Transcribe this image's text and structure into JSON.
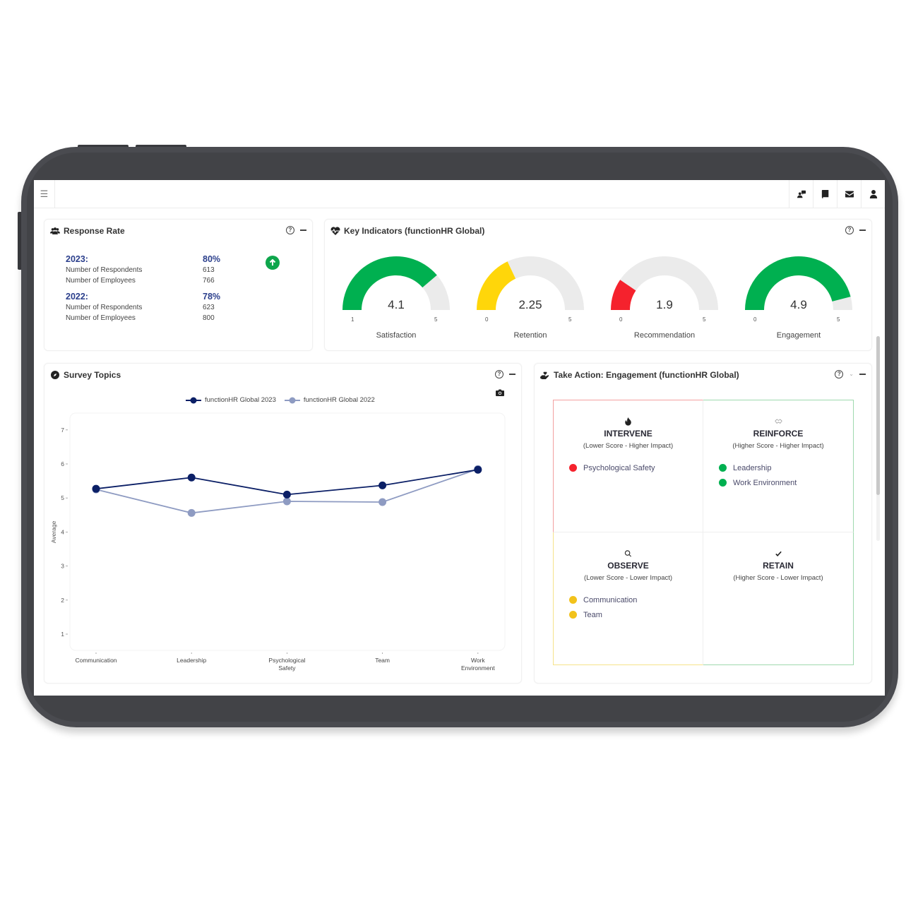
{
  "topbar": {
    "menu_icon": "hamburger-icon",
    "icons": [
      "users-chat-icon",
      "book-icon",
      "envelope-icon",
      "user-icon"
    ]
  },
  "response_rate": {
    "title": "Response Rate",
    "icon": "users-icon",
    "years": [
      {
        "year": "2023:",
        "rate": "80%",
        "rows": [
          {
            "label": "Number of Respondents",
            "value": "613"
          },
          {
            "label": "Number of Employees",
            "value": "766"
          }
        ]
      },
      {
        "year": "2022:",
        "rate": "78%",
        "rows": [
          {
            "label": "Number of Respondents",
            "value": "623"
          },
          {
            "label": "Number of Employees",
            "value": "800"
          }
        ]
      }
    ],
    "trend": "up"
  },
  "key_indicators": {
    "title": "Key Indicators (functionHR Global)",
    "icon": "heartbeat-icon",
    "gauges": [
      {
        "label": "Satisfaction",
        "value": "4.1",
        "min": "1",
        "max": "5",
        "fill_fraction": 0.775,
        "color": "#00b050"
      },
      {
        "label": "Retention",
        "value": "2.25",
        "min": "0",
        "max": "5",
        "fill_fraction": 0.36,
        "color": "#ffd60a"
      },
      {
        "label": "Recommendation",
        "value": "1.9",
        "min": "0",
        "max": "5",
        "fill_fraction": 0.19,
        "color": "#f5222d"
      },
      {
        "label": "Engagement",
        "value": "4.9",
        "min": "0",
        "max": "5",
        "fill_fraction": 0.92,
        "color": "#00b050"
      }
    ],
    "track_color": "#ebebeb"
  },
  "survey_topics": {
    "title": "Survey Topics",
    "icon": "compass-icon"
  },
  "chart_data": {
    "type": "line",
    "title": "Survey Topics",
    "xlabel": "",
    "ylabel": "Average",
    "categories": [
      "Communication",
      "Leadership",
      "Psychological Safety",
      "Team",
      "Work Environment"
    ],
    "category_lines": [
      [
        "Communication"
      ],
      [
        "Leadership"
      ],
      [
        "Psychological",
        "Safety"
      ],
      [
        "Team"
      ],
      [
        "Work",
        "Environment"
      ]
    ],
    "series": [
      {
        "name": "functionHR Global 2023",
        "color": "#0b1f66",
        "values": [
          5.27,
          5.6,
          5.1,
          5.37,
          5.83
        ]
      },
      {
        "name": "functionHR Global 2022",
        "color": "#8e9bc2",
        "values": [
          5.25,
          4.56,
          4.9,
          4.88,
          5.85
        ]
      }
    ],
    "yticks": [
      1,
      2,
      3,
      4,
      5,
      6,
      7
    ],
    "ylim": [
      0.6,
      7.2
    ],
    "grid": false,
    "legend": "top-center"
  },
  "take_action": {
    "title": "Take Action: Engagement (functionHR Global)",
    "icon": "hand-holding-heart-icon",
    "quadrants": [
      {
        "key": "intervene",
        "icon": "fire-icon",
        "title": "INTERVENE",
        "subtitle": "(Lower Score - Higher Impact)",
        "dot_color": "#f5222d",
        "items": [
          "Psychological Safety"
        ]
      },
      {
        "key": "reinforce",
        "icon": "handshake-icon",
        "title": "REINFORCE",
        "subtitle": "(Higher Score - Higher Impact)",
        "dot_color": "#00b050",
        "items": [
          "Leadership",
          "Work Environment"
        ]
      },
      {
        "key": "observe",
        "icon": "search-icon",
        "title": "OBSERVE",
        "subtitle": "(Lower Score - Lower Impact)",
        "dot_color": "#f2c21b",
        "items": [
          "Communication",
          "Team"
        ]
      },
      {
        "key": "retain",
        "icon": "check-icon",
        "title": "RETAIN",
        "subtitle": "(Higher Score - Lower Impact)",
        "dot_color": "#00b050",
        "items": []
      }
    ]
  },
  "common": {
    "help_glyph": "?"
  },
  "colors": {
    "accent_blue": "#2b3f8c",
    "success_green": "#0ea64c"
  }
}
